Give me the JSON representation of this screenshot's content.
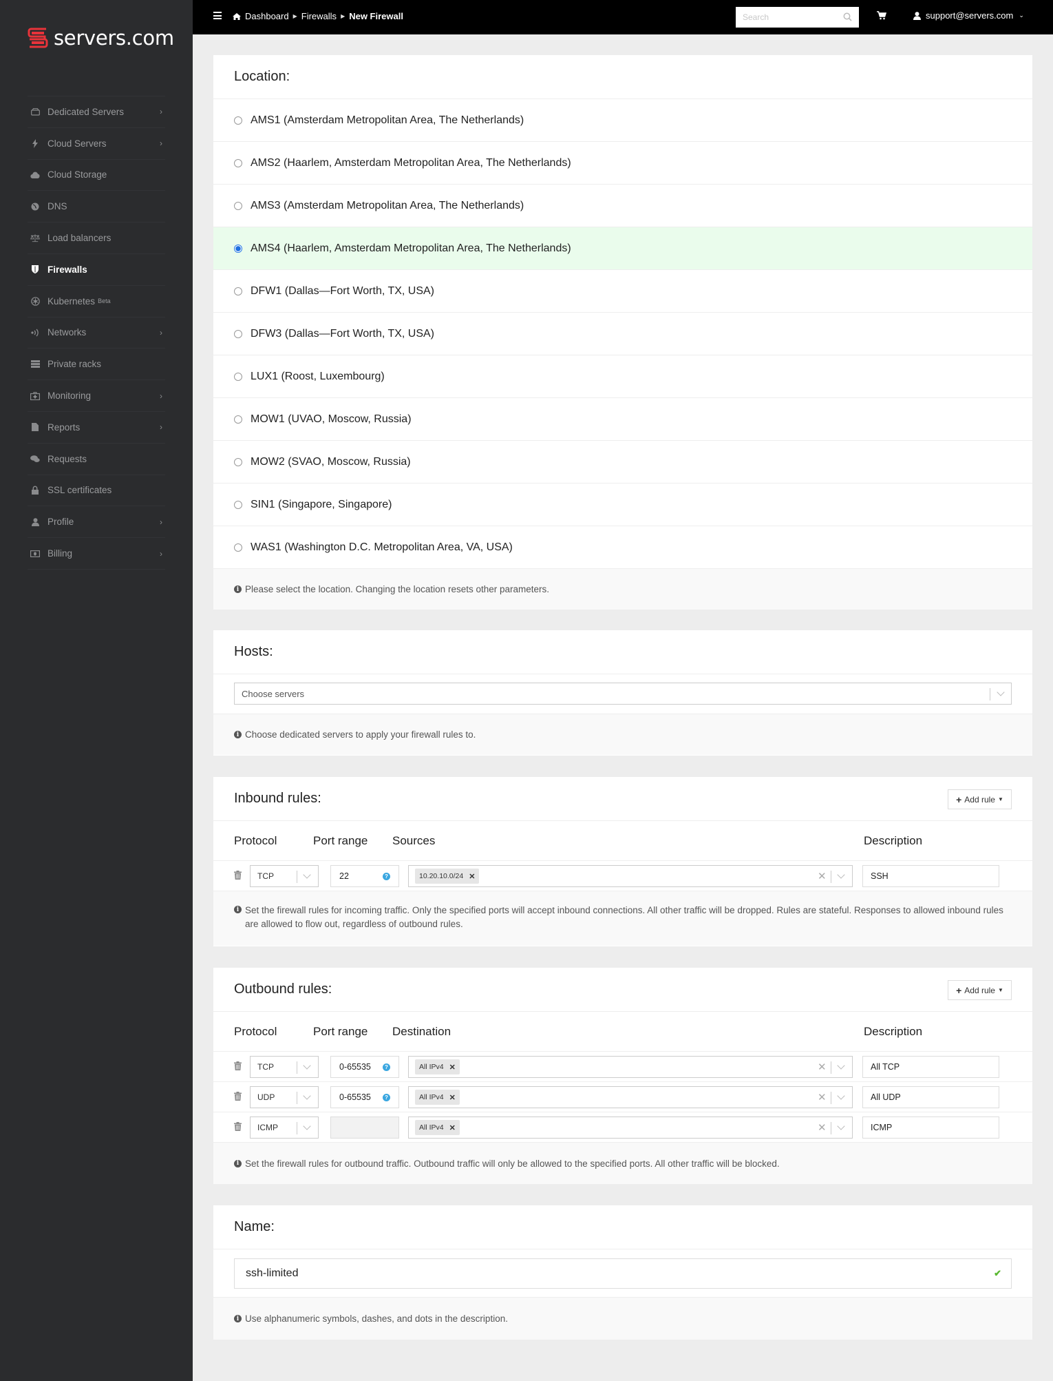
{
  "brand": {
    "name": "servers.com",
    "accent": "#e8333a"
  },
  "sidebar": {
    "items": [
      {
        "label": "Dedicated Servers",
        "icon": "hdd-icon",
        "chevron": true
      },
      {
        "label": "Cloud Servers",
        "icon": "bolt-icon",
        "chevron": true
      },
      {
        "label": "Cloud Storage",
        "icon": "cloud-icon",
        "chevron": false
      },
      {
        "label": "DNS",
        "icon": "globe-icon",
        "chevron": false
      },
      {
        "label": "Load balancers",
        "icon": "scale-icon",
        "chevron": false
      },
      {
        "label": "Firewalls",
        "icon": "shield-icon",
        "chevron": false,
        "active": true
      },
      {
        "label": "Kubernetes",
        "badge": "Beta",
        "icon": "kubernetes-icon",
        "chevron": false
      },
      {
        "label": "Networks",
        "icon": "signal-icon",
        "chevron": true
      },
      {
        "label": "Private racks",
        "icon": "rack-icon",
        "chevron": false
      },
      {
        "label": "Monitoring",
        "icon": "medkit-icon",
        "chevron": true
      },
      {
        "label": "Reports",
        "icon": "file-icon",
        "chevron": true
      },
      {
        "label": "Requests",
        "icon": "comments-icon",
        "chevron": false
      },
      {
        "label": "SSL certificates",
        "icon": "lock-icon",
        "chevron": false
      },
      {
        "label": "Profile",
        "icon": "user-icon",
        "chevron": true
      },
      {
        "label": "Billing",
        "icon": "money-icon",
        "chevron": true
      }
    ]
  },
  "topbar": {
    "breadcrumb": [
      "Dashboard",
      "Firewalls",
      "New Firewall"
    ],
    "search_placeholder": "Search",
    "user": "support@servers.com"
  },
  "location": {
    "title": "Location:",
    "options": [
      {
        "label": "AMS1 (Amsterdam Metropolitan Area, The Netherlands)",
        "selected": false
      },
      {
        "label": "AMS2 (Haarlem, Amsterdam Metropolitan Area, The Netherlands)",
        "selected": false
      },
      {
        "label": "AMS3 (Amsterdam Metropolitan Area, The Netherlands)",
        "selected": false
      },
      {
        "label": "AMS4 (Haarlem, Amsterdam Metropolitan Area, The Netherlands)",
        "selected": true
      },
      {
        "label": "DFW1 (Dallas—Fort Worth, TX, USA)",
        "selected": false
      },
      {
        "label": "DFW3 (Dallas—Fort Worth, TX, USA)",
        "selected": false
      },
      {
        "label": "LUX1 (Roost, Luxembourg)",
        "selected": false
      },
      {
        "label": "MOW1 (UVAO, Moscow, Russia)",
        "selected": false
      },
      {
        "label": "MOW2 (SVAO, Moscow, Russia)",
        "selected": false
      },
      {
        "label": "SIN1 (Singapore, Singapore)",
        "selected": false
      },
      {
        "label": "WAS1 (Washington D.C. Metropolitan Area, VA, USA)",
        "selected": false
      }
    ],
    "hint": "Please select the location. Changing the location resets other parameters."
  },
  "hosts": {
    "title": "Hosts:",
    "placeholder": "Choose servers",
    "hint": "Choose dedicated servers to apply your firewall rules to."
  },
  "inbound": {
    "title": "Inbound rules:",
    "add_label": "Add rule",
    "columns": [
      "Protocol",
      "Port range",
      "Sources",
      "Description"
    ],
    "rules": [
      {
        "protocol": "TCP",
        "port": "22",
        "tag": "10.20.10.0/24",
        "description": "SSH"
      }
    ],
    "hint": "Set the firewall rules for incoming traffic. Only the specified ports will accept inbound connections. All other traffic will be dropped. Rules are stateful. Responses to allowed inbound rules are allowed to flow out, regardless of outbound rules."
  },
  "outbound": {
    "title": "Outbound rules:",
    "add_label": "Add rule",
    "columns": [
      "Protocol",
      "Port range",
      "Destination",
      "Description"
    ],
    "rules": [
      {
        "protocol": "TCP",
        "port": "0-65535",
        "tag": "All IPv4",
        "description": "All TCP"
      },
      {
        "protocol": "UDP",
        "port": "0-65535",
        "tag": "All IPv4",
        "description": "All UDP"
      },
      {
        "protocol": "ICMP",
        "port": "",
        "tag": "All IPv4",
        "description": "ICMP"
      }
    ],
    "hint": "Set the firewall rules for outbound traffic. Outbound traffic will only be allowed to the specified ports. All other traffic will be blocked."
  },
  "name": {
    "title": "Name:",
    "value": "ssh-limited",
    "hint": "Use alphanumeric symbols, dashes, and dots in the description."
  }
}
